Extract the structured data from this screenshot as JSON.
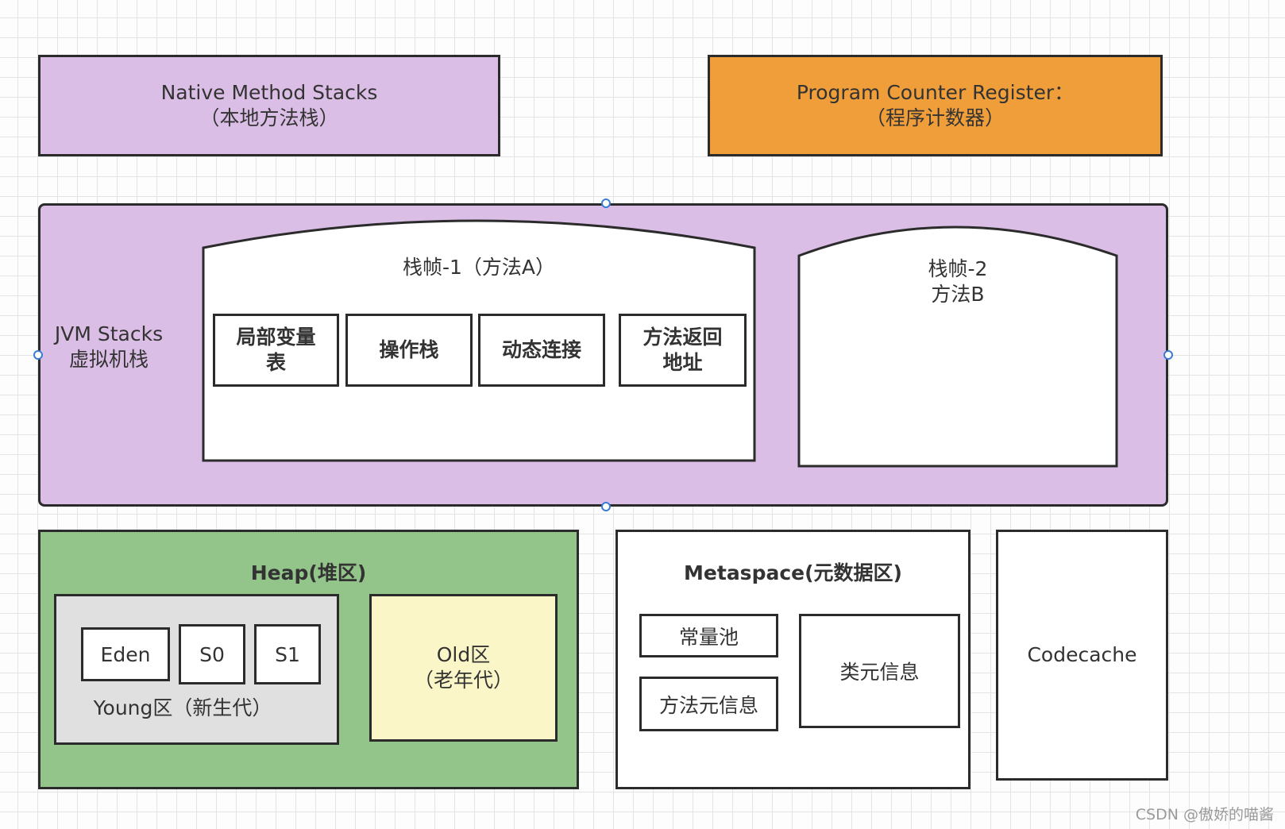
{
  "native_stacks": {
    "line1": "Native Method Stacks",
    "line2": "（本地方法栈）"
  },
  "pc_register": {
    "line1": "Program Counter Register：",
    "line2": "（程序计数器）"
  },
  "jvm_stacks": {
    "line1": "JVM Stacks",
    "line2": "虚拟机栈",
    "frame1": {
      "title": "栈帧-1（方法A）",
      "cells": [
        {
          "line1": "局部变量",
          "line2": "表"
        },
        {
          "line1": "操作栈",
          "line2": ""
        },
        {
          "line1": "动态连接",
          "line2": ""
        },
        {
          "line1": "方法返回",
          "line2": "地址"
        }
      ]
    },
    "frame2": {
      "line1": "栈帧-2",
      "line2": "方法B"
    }
  },
  "heap": {
    "title": "Heap(堆区)",
    "young": {
      "label": "Young区（新生代）",
      "eden": "Eden",
      "s0": "S0",
      "s1": "S1"
    },
    "old": {
      "line1": "Old区",
      "line2": "（老年代）"
    }
  },
  "metaspace": {
    "title": "Metaspace(元数据区)",
    "constant_pool": "常量池",
    "method_meta": "方法元信息",
    "class_meta": "类元信息"
  },
  "codecache": "Codecache",
  "watermark": "CSDN @傲娇的喵酱",
  "colors": {
    "purple": "#dbbee5",
    "orange": "#f09e3a",
    "green": "#93c58a",
    "gray": "#e0e0e0",
    "yellow": "#fbf6c7",
    "handle": "#3a7bd5"
  }
}
